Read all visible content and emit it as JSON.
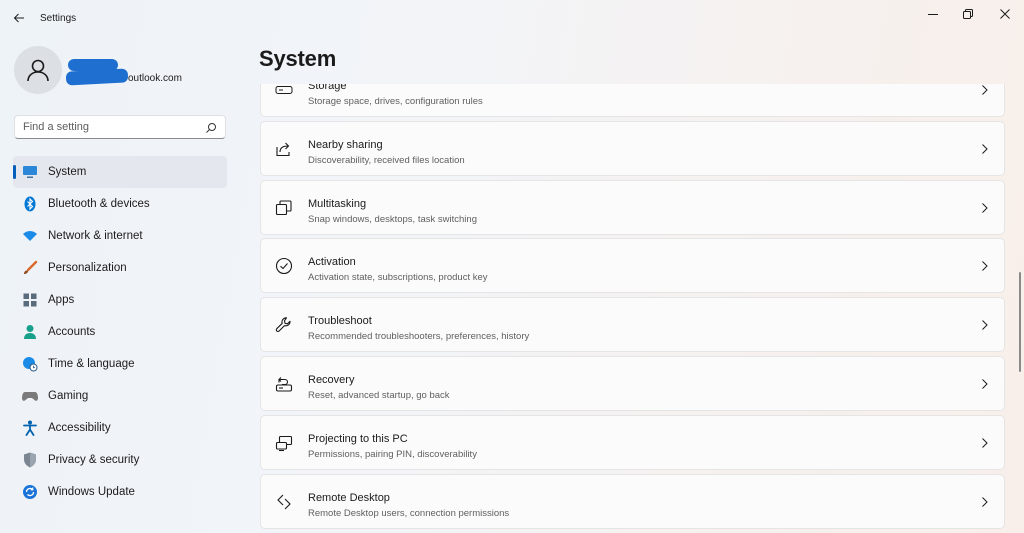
{
  "window": {
    "title": "Settings"
  },
  "profile": {
    "name": "",
    "email": "outlook.com"
  },
  "search": {
    "placeholder": "Find a setting"
  },
  "nav": {
    "items": [
      {
        "label": "System",
        "icon": "monitor-icon",
        "active": true,
        "color": "#2b88d8"
      },
      {
        "label": "Bluetooth & devices",
        "icon": "bluetooth-icon",
        "color": "#0078d4"
      },
      {
        "label": "Network & internet",
        "icon": "wifi-icon",
        "color": "#1a8ce8"
      },
      {
        "label": "Personalization",
        "icon": "brush-icon",
        "color": "#d9682c"
      },
      {
        "label": "Apps",
        "icon": "apps-icon",
        "color": "#5a6b7b"
      },
      {
        "label": "Accounts",
        "icon": "person-icon",
        "color": "#18a08a"
      },
      {
        "label": "Time & language",
        "icon": "globe-clock-icon",
        "color": "#1a8ce8"
      },
      {
        "label": "Gaming",
        "icon": "gamepad-icon",
        "color": "#7a7a7a"
      },
      {
        "label": "Accessibility",
        "icon": "accessibility-icon",
        "color": "#0063b1"
      },
      {
        "label": "Privacy & security",
        "icon": "shield-icon",
        "color": "#7a8591"
      },
      {
        "label": "Windows Update",
        "icon": "update-icon",
        "color": "#1a73d9"
      }
    ]
  },
  "main": {
    "title": "System",
    "cards": [
      {
        "title": "Storage",
        "desc": "Storage space, drives, configuration rules",
        "icon": "storage-icon"
      },
      {
        "title": "Nearby sharing",
        "desc": "Discoverability, received files location",
        "icon": "share-icon"
      },
      {
        "title": "Multitasking",
        "desc": "Snap windows, desktops, task switching",
        "icon": "multitask-icon"
      },
      {
        "title": "Activation",
        "desc": "Activation state, subscriptions, product key",
        "icon": "check-circle-icon"
      },
      {
        "title": "Troubleshoot",
        "desc": "Recommended troubleshooters, preferences, history",
        "icon": "wrench-icon"
      },
      {
        "title": "Recovery",
        "desc": "Reset, advanced startup, go back",
        "icon": "recovery-icon"
      },
      {
        "title": "Projecting to this PC",
        "desc": "Permissions, pairing PIN, discoverability",
        "icon": "projector-icon"
      },
      {
        "title": "Remote Desktop",
        "desc": "Remote Desktop users, connection permissions",
        "icon": "remote-desktop-icon"
      }
    ]
  },
  "theme": {
    "accent": "#005fb8",
    "redact": "#1f6fd1"
  }
}
